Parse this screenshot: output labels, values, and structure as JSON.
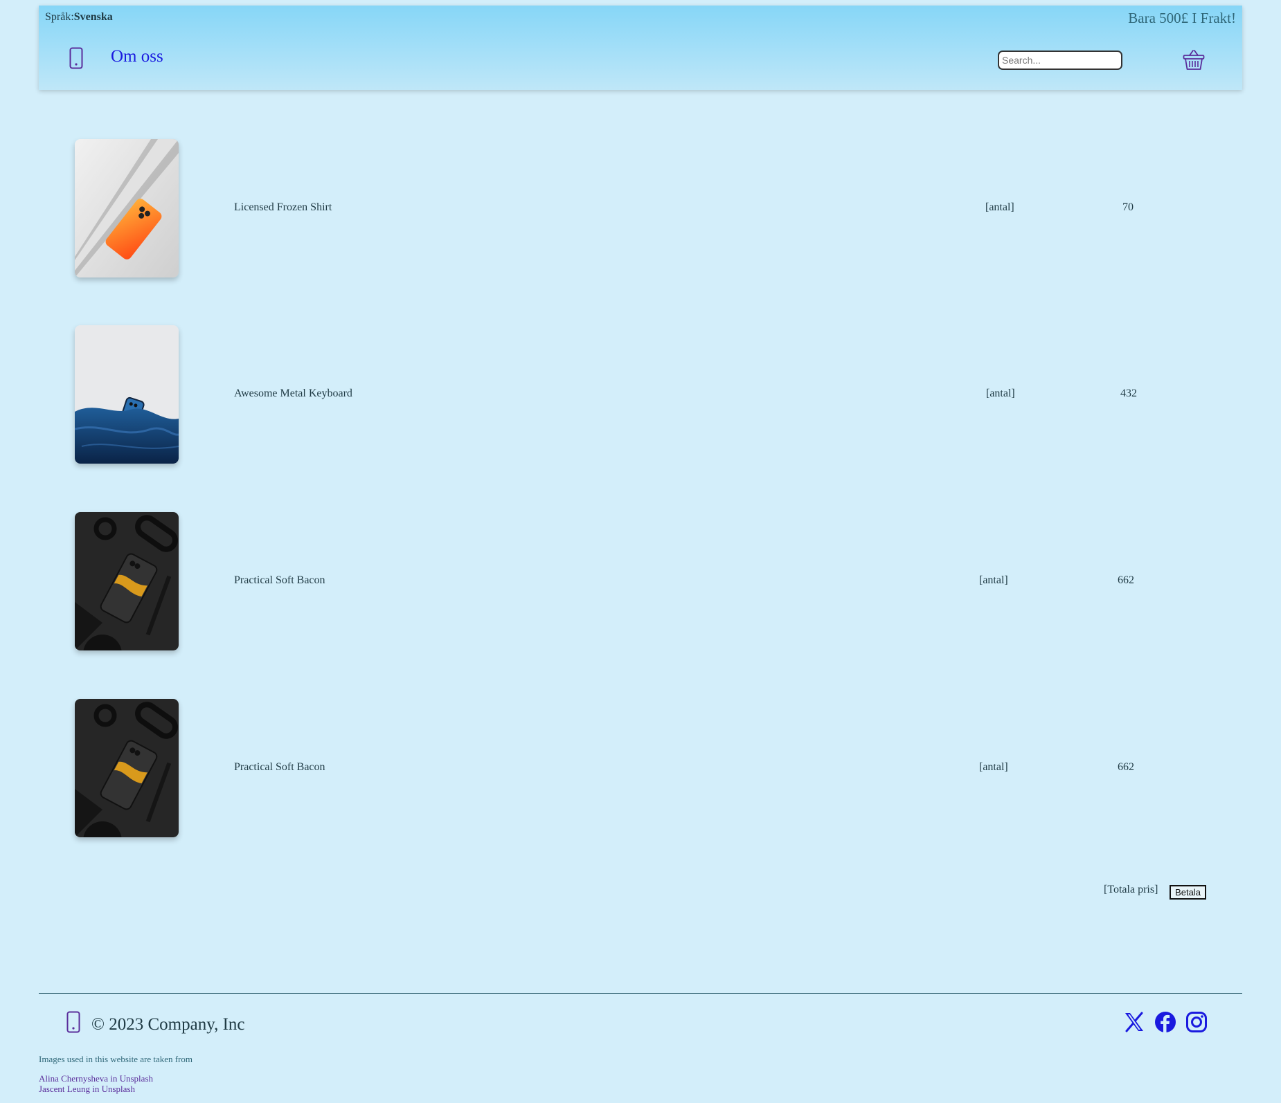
{
  "header": {
    "language_label": "Språk:",
    "language_value": "Svenska",
    "promo": "Bara 500£ I Frakt!",
    "nav_link": "Om oss",
    "search_placeholder": "Search...",
    "phone_icon": "phone-icon",
    "cart_icon": "basket-icon"
  },
  "cart": {
    "items": [
      {
        "name": "Licensed Frozen Shirt",
        "qty": "[antal]",
        "price": "70"
      },
      {
        "name": "Awesome Metal Keyboard",
        "qty": "[antal]",
        "price": "432"
      },
      {
        "name": "Practical Soft Bacon",
        "qty": "[antal]",
        "price": "662"
      },
      {
        "name": "Practical Soft Bacon",
        "qty": "[antal]",
        "price": "662"
      }
    ],
    "total_label": "[Totala pris]",
    "pay_label": "Betala"
  },
  "footer": {
    "copyright": "© 2023 Company, Inc",
    "credits_note": "Images used in this website are taken from",
    "credits": [
      "Alina Chernysheva in Unsplash",
      "Jascent Leung in Unsplash"
    ],
    "social_icons": [
      "x-twitter-icon",
      "facebook-icon",
      "instagram-icon"
    ]
  },
  "colors": {
    "page_bg": "#d3eefa",
    "header_top": "#86d6f7",
    "link": "#1a1adf",
    "icon": "#5a2d9b"
  }
}
